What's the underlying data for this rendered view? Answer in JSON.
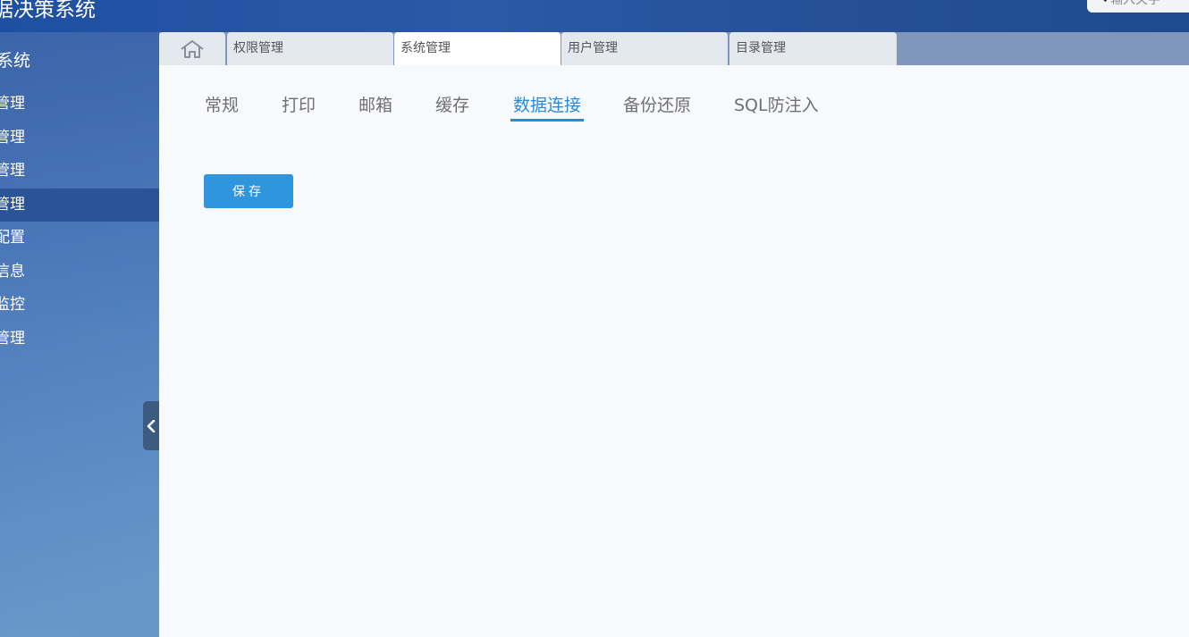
{
  "header": {
    "title": "据决策系统",
    "search_placeholder": "输入关字"
  },
  "sidebar": {
    "title": "系统",
    "items": [
      {
        "label": "管理",
        "active": false
      },
      {
        "label": "管理",
        "active": false
      },
      {
        "label": "管理",
        "active": false
      },
      {
        "label": "管理",
        "active": true
      },
      {
        "label": "配置",
        "active": false
      },
      {
        "label": "信息",
        "active": false
      },
      {
        "label": "监控",
        "active": false
      },
      {
        "label": "管理",
        "active": false
      }
    ]
  },
  "tabs": [
    {
      "label": "权限管理",
      "active": false
    },
    {
      "label": "系统管理",
      "active": true
    },
    {
      "label": "用户管理",
      "active": false
    },
    {
      "label": "目录管理",
      "active": false
    }
  ],
  "subtabs": [
    {
      "label": "常规",
      "active": false
    },
    {
      "label": "打印",
      "active": false
    },
    {
      "label": "邮箱",
      "active": false
    },
    {
      "label": "缓存",
      "active": false
    },
    {
      "label": "数据连接",
      "active": true
    },
    {
      "label": "备份还原",
      "active": false
    },
    {
      "label": "SQL防注入",
      "active": false
    }
  ],
  "actions": {
    "save_label": "保存"
  },
  "colors": {
    "accent": "#2b8ad6",
    "button": "#2f95dd",
    "sidebar_active": "#2a5496"
  }
}
